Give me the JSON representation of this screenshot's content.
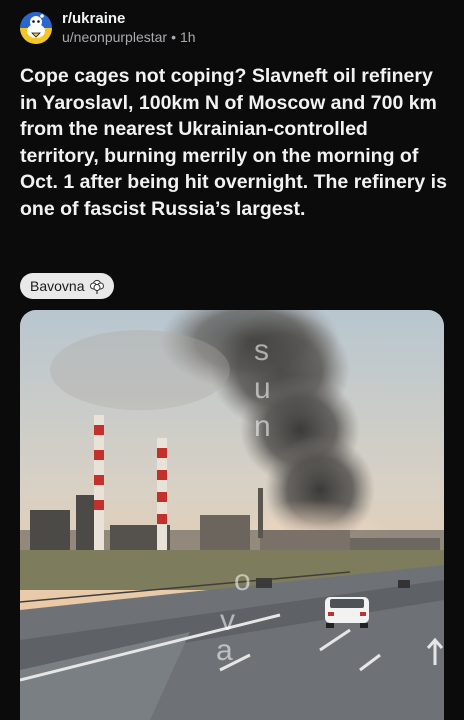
{
  "post": {
    "subreddit": "r/ukraine",
    "author": "u/neonpurplestar",
    "separator": "•",
    "age": "1h",
    "title": "Cope cages not coping? Slavneft oil refinery in Yaroslavl, 100km N of Moscow and 700 km from the nearest Ukrainian-controlled territory, burning merrily on the morning of Oct. 1 after being hit overnight. The refinery is one of fascist Russia’s largest.",
    "flair": "Bavovna",
    "flair_icon": "cotton-icon"
  },
  "media": {
    "watermark": [
      "s",
      "u",
      "n",
      "o",
      "v",
      "a"
    ]
  },
  "colors": {
    "background": "#0b0b0c",
    "avatar": "#1e63c9",
    "flair_bg": "#e9e9ea"
  }
}
